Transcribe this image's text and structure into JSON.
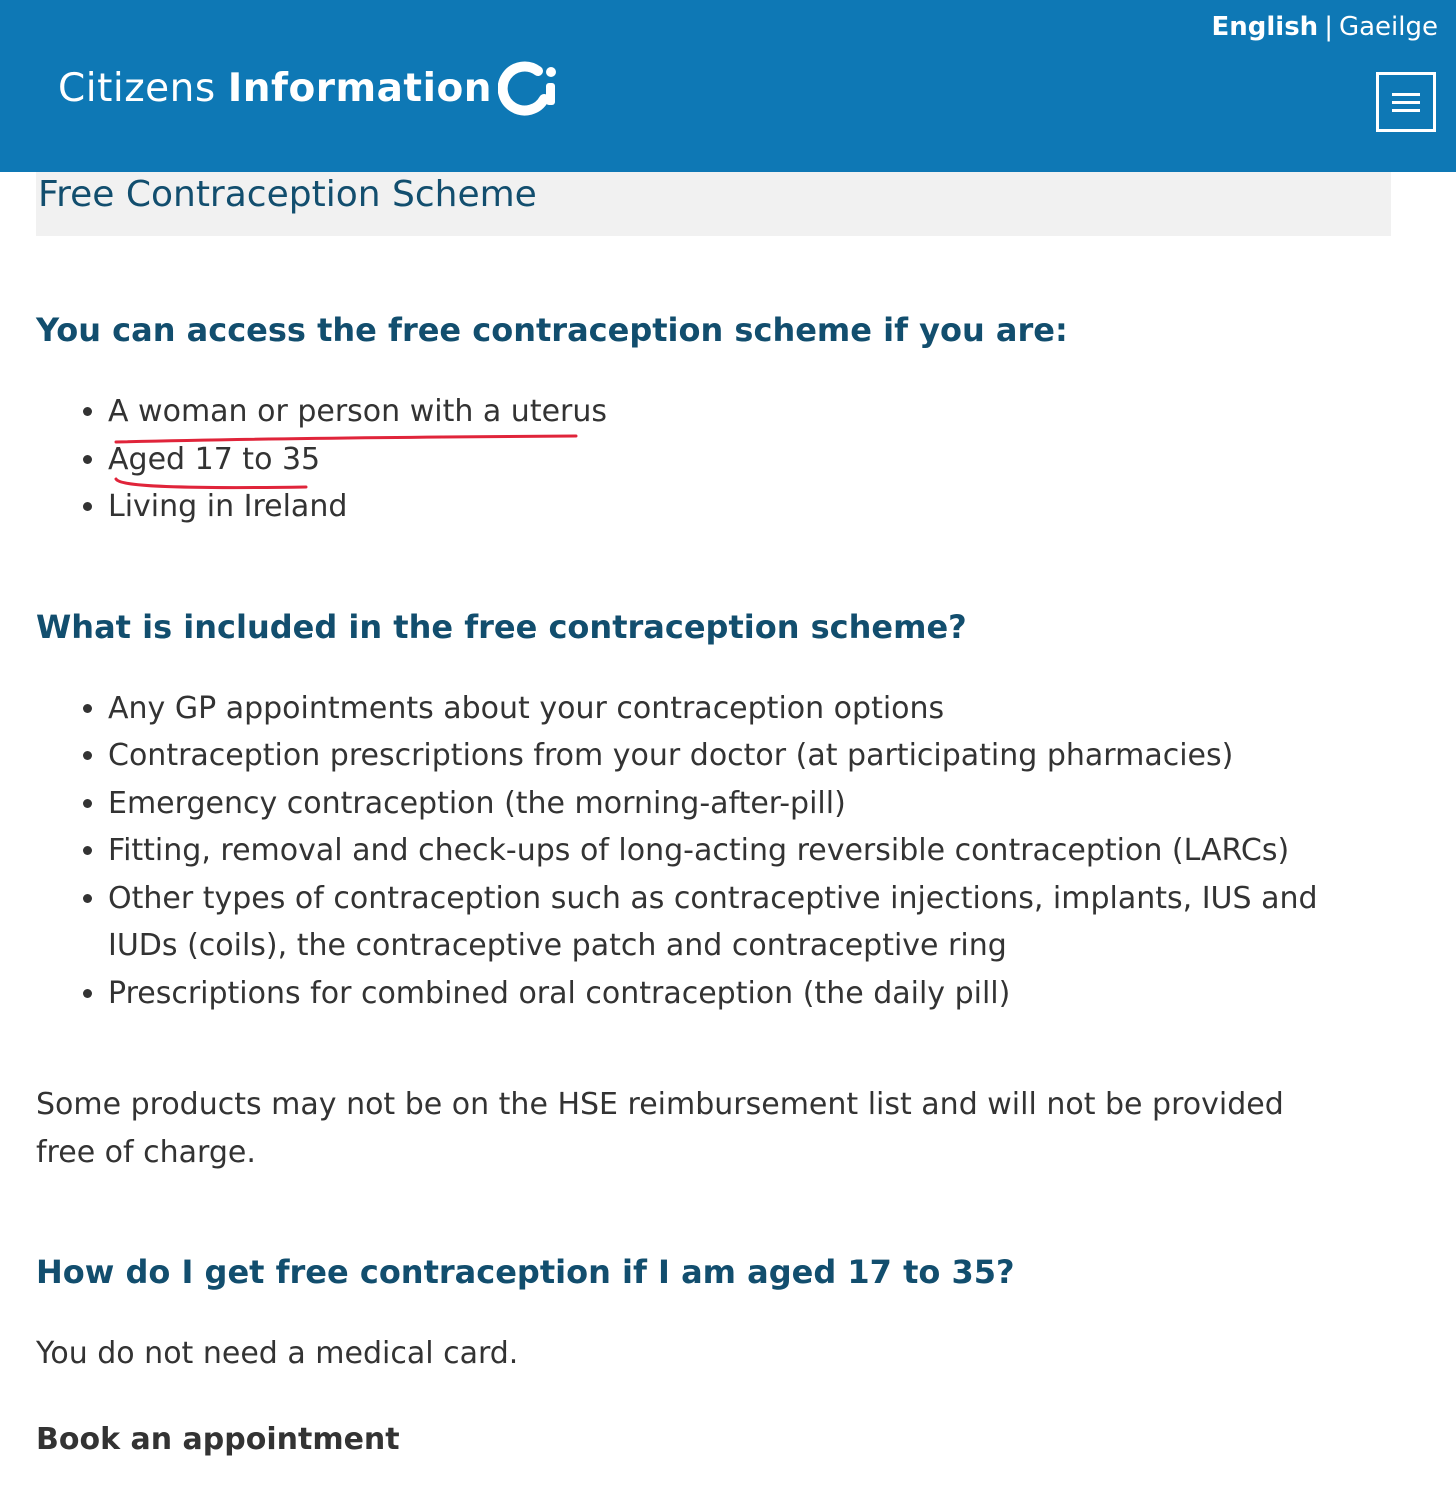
{
  "header": {
    "language_active": "English",
    "language_separator": "|",
    "language_other": "Gaeilge",
    "logo_light": "Citizens",
    "logo_bold": "Information",
    "brand_color": "#0e78b5"
  },
  "page": {
    "title": "Free Contraception Scheme"
  },
  "sections": {
    "access_heading": "You can access the free contraception scheme if you are:",
    "access_items": [
      "A woman or person with a uterus",
      "Aged 17 to 35",
      "Living in Ireland"
    ],
    "included_heading": "What is included in the free contraception scheme?",
    "included_items": [
      "Any GP appointments about your contraception options",
      "Contraception prescriptions from your doctor (at participating pharmacies)",
      "Emergency contraception (the morning-after-pill)",
      "Fitting, removal and check-ups of long-acting reversible contraception (LARCs)",
      "Other types of contraception such as contraceptive injections, implants, IUS and IUDs (coils), the contraceptive patch and contraceptive ring",
      "Prescriptions for combined oral contraception (the daily pill)"
    ],
    "reimbursement_note": "Some products may not be on the HSE reimbursement list and will not be provided free of charge.",
    "how_heading": "How do I get free contraception if I am aged 17 to 35?",
    "medical_card_note": "You do not need a medical card.",
    "book_heading": "Book an appointment"
  },
  "annotations": {
    "underline_color": "#e0243a"
  }
}
